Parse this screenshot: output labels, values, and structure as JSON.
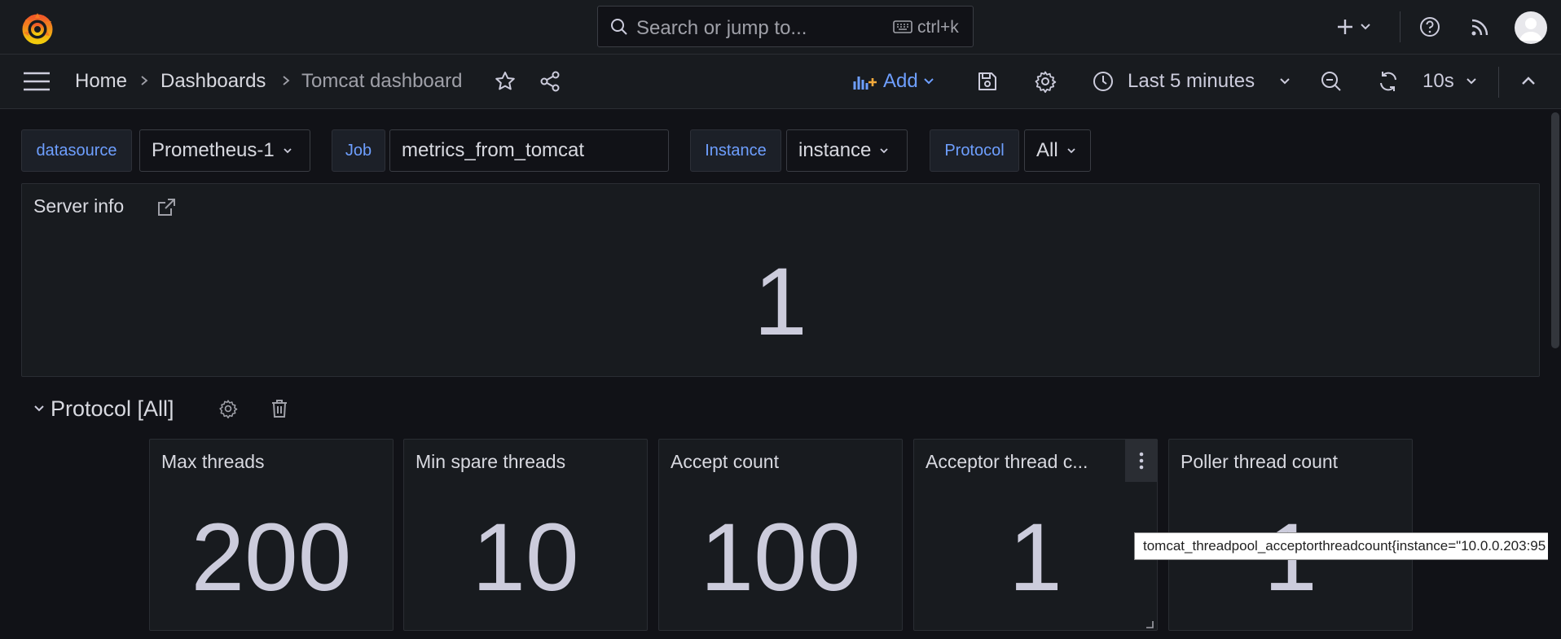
{
  "topbar": {
    "search_placeholder": "Search or jump to...",
    "search_shortcut": "ctrl+k"
  },
  "breadcrumbs": [
    "Home",
    "Dashboards",
    "Tomcat dashboard"
  ],
  "toolbar": {
    "add_label": "Add",
    "time_range": "Last 5 minutes",
    "refresh_interval": "10s"
  },
  "variables": [
    {
      "label": "datasource",
      "value": "Prometheus-1"
    },
    {
      "label": "Job",
      "value": "metrics_from_tomcat"
    },
    {
      "label": "Instance",
      "value": "instance"
    },
    {
      "label": "Protocol",
      "value": "All"
    }
  ],
  "server_info": {
    "title": "Server info",
    "value": "1"
  },
  "row": {
    "title": "Protocol [All]"
  },
  "stats": [
    {
      "title": "Max threads",
      "value": "200"
    },
    {
      "title": "Min spare threads",
      "value": "10"
    },
    {
      "title": "Accept count",
      "value": "100"
    },
    {
      "title": "Acceptor thread c...",
      "value": "1"
    },
    {
      "title": "Poller thread count",
      "value": "1"
    }
  ],
  "tooltip": "tomcat_threadpool_acceptorthreadcount{instance=\"10.0.0.203:95",
  "colors": {
    "accent": "#6e9fff",
    "background": "#111217",
    "panel": "#181b1f"
  }
}
